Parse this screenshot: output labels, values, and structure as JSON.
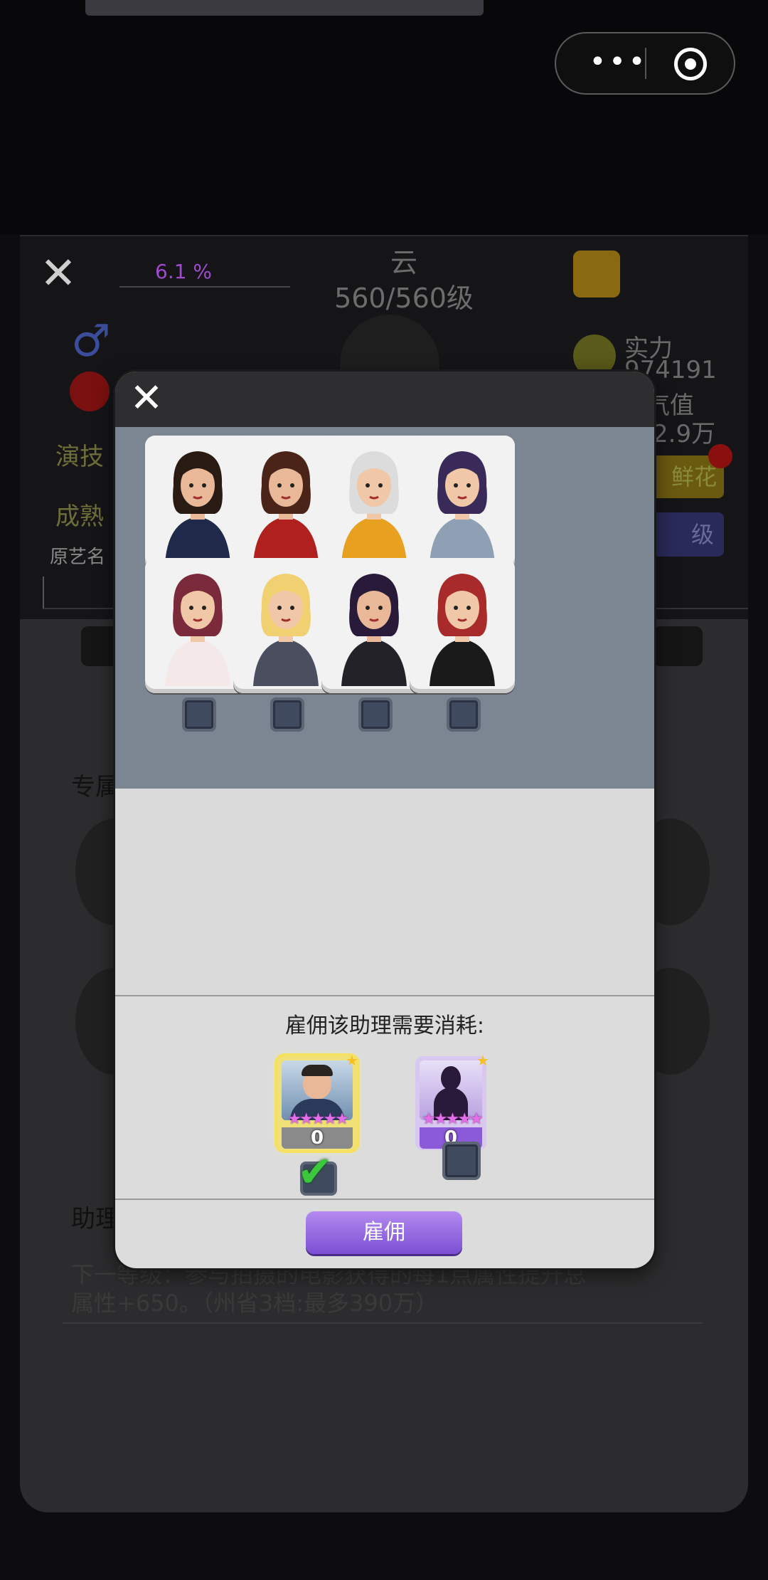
{
  "background": {
    "player_name": "云",
    "level_text": "560/560级",
    "id_text": "6.1 %",
    "power_label": "实力",
    "power_value": "974191",
    "value_label": "气值",
    "value_amount": "2.9万",
    "flower_button": "鲜花",
    "upgrade_button": "级",
    "acting_label": "演技",
    "maturity_label": "成熟",
    "former_name_label": "原艺名",
    "exclusive_label": "专属",
    "assistant_label": "助理",
    "desc_line1": "下一等级：参与拍摄的电影获得的每1点属性提升总",
    "desc_line2": "属性+650。（州省3档:最多390万）"
  },
  "capsule": {
    "dots": "•••"
  },
  "modal": {
    "close_icon": "close-icon",
    "assistants": [
      {
        "name": "assistant-football-girl",
        "hair": "#2a1a14",
        "outfit": "#1f2a4a",
        "skin": "#e8b898"
      },
      {
        "name": "assistant-red-dress-girl",
        "hair": "#4a2418",
        "outfit": "#b0201e",
        "skin": "#e8b898"
      },
      {
        "name": "assistant-director-boy",
        "hair": "#dcdcdc",
        "outfit": "#e8a020",
        "skin": "#f0c8a8"
      },
      {
        "name": "assistant-photographer",
        "hair": "#3a2a5a",
        "outfit": "#8fa0b4",
        "skin": "#f0c8a8"
      },
      {
        "name": "assistant-burger-girl",
        "hair": "#7a2a3a",
        "outfit": "#f4e8e8",
        "skin": "#f0c8a8"
      },
      {
        "name": "assistant-hat-blonde",
        "hair": "#f0d070",
        "outfit": "#4a4e5e",
        "skin": "#f0c8a8"
      },
      {
        "name": "assistant-purple-hair",
        "hair": "#2a1a3a",
        "outfit": "#222228",
        "skin": "#e8b898"
      },
      {
        "name": "assistant-red-hair-dress",
        "hair": "#a82a2a",
        "outfit": "#1a1a1a",
        "skin": "#f0c8a8"
      }
    ],
    "cost_label": "雇佣该助理需要消耗:",
    "cost_cards": [
      {
        "count": "0",
        "stars": "★★★★★",
        "selected": true
      },
      {
        "count": "0",
        "stars": "★★★★★",
        "selected": false
      }
    ],
    "checkmark_icon": "checkmark-icon",
    "hire_button": "雇佣"
  }
}
